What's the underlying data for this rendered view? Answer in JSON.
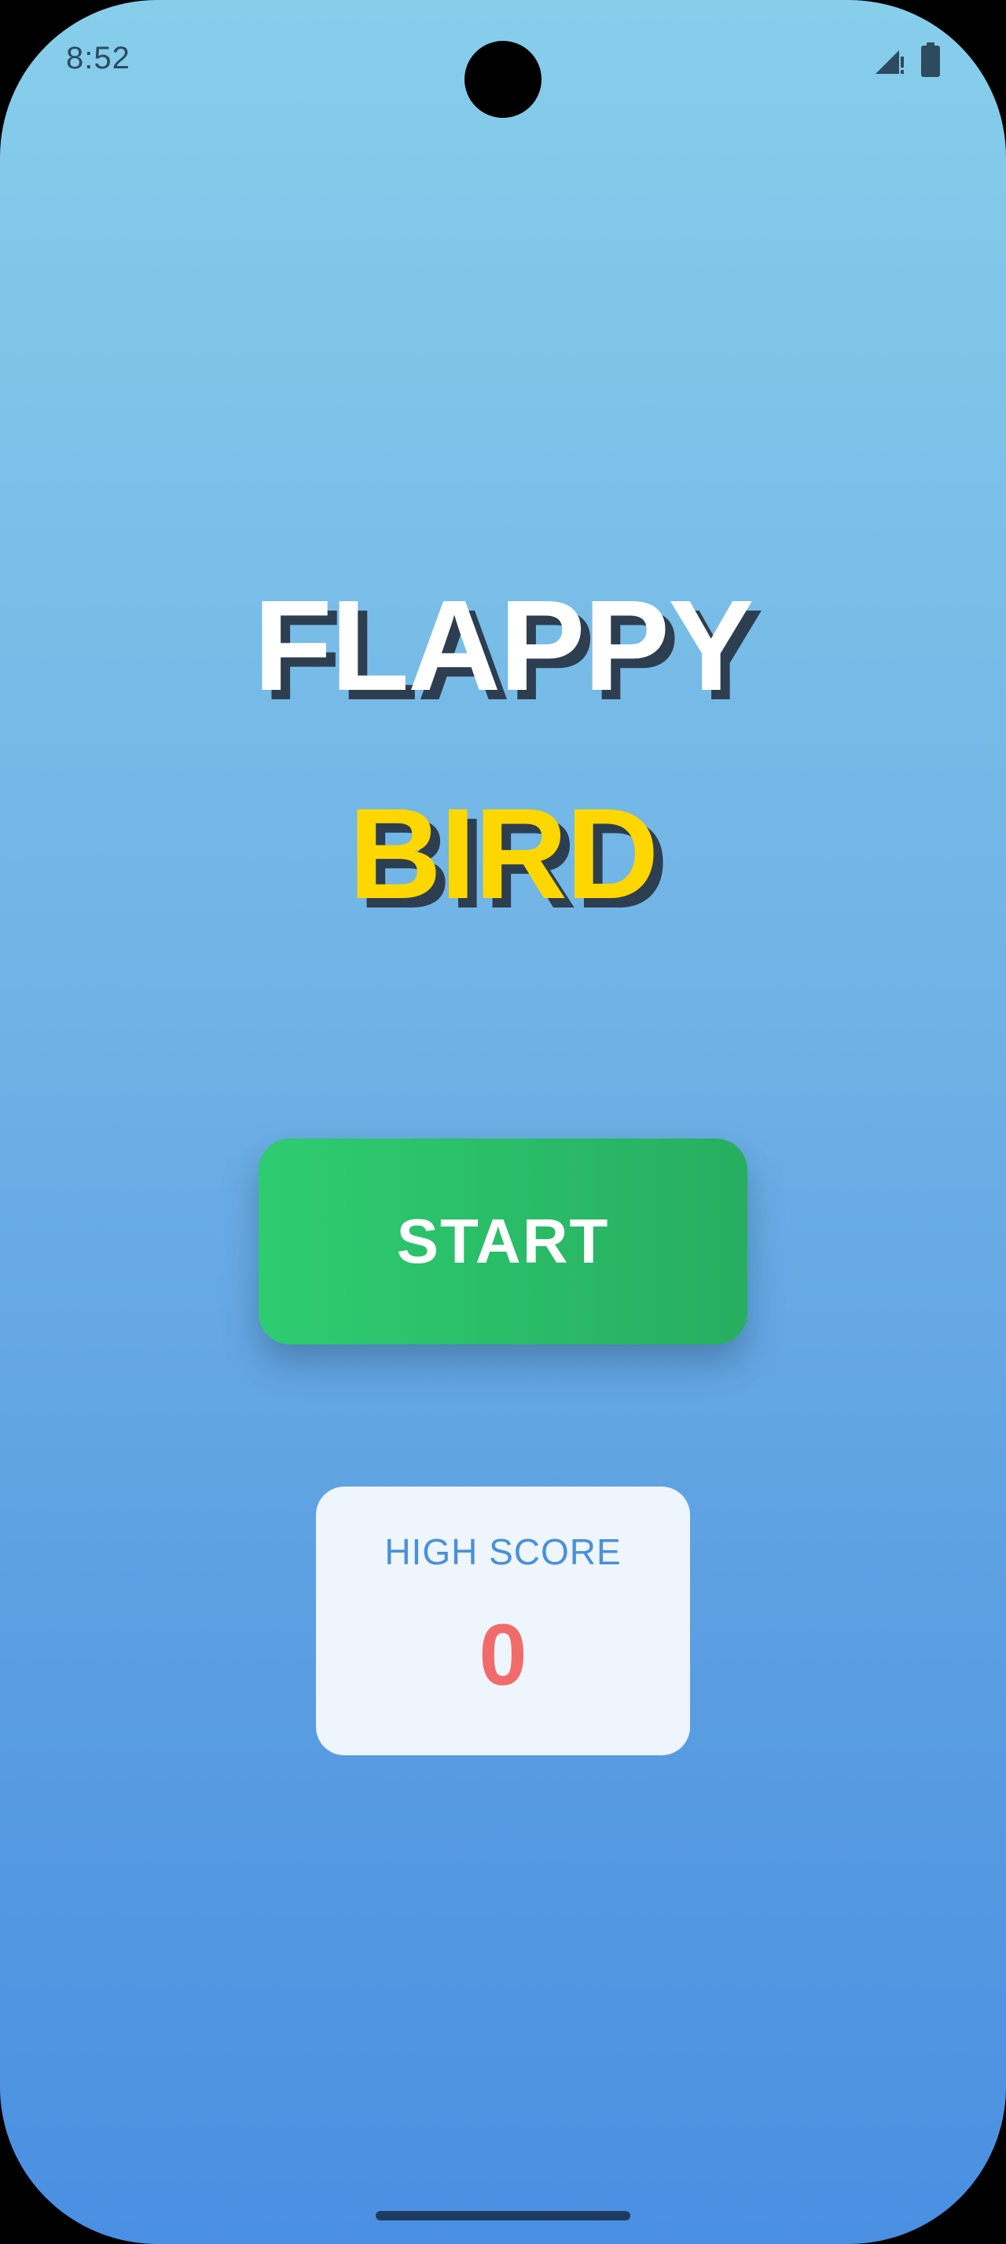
{
  "status_bar": {
    "time": "8:52",
    "signal_icon": "signal-no-data-icon",
    "battery_icon": "battery-icon"
  },
  "title": {
    "line1": "FLAPPY",
    "line2": "BIRD"
  },
  "start_button": {
    "label": "START"
  },
  "high_score": {
    "label": "HIGH SCORE",
    "value": "0"
  },
  "colors": {
    "sky_top": "#87CEEB",
    "sky_bottom": "#4A8FE2",
    "title_white": "#FFFFFF",
    "title_yellow": "#FFD700",
    "title_shadow": "#2D3E50",
    "button_green": "#2ECC71",
    "button_green_dark": "#27AE60",
    "score_label": "#4A90D9",
    "score_value": "#F26B6B",
    "card_bg": "#EEF5FC"
  }
}
